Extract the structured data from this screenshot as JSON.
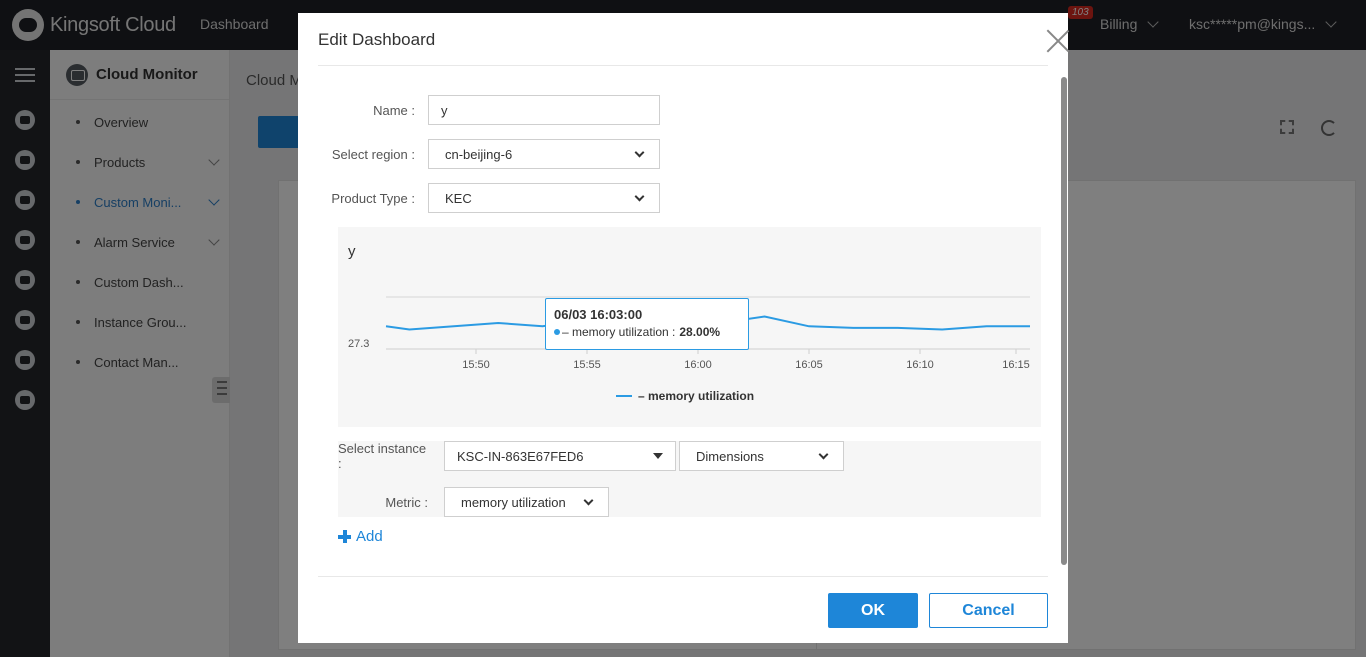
{
  "topbar": {
    "logo_text": "Kingsoft Cloud",
    "nav_dashboard": "Dashboard",
    "badge_count": "103",
    "billing_label": "Billing",
    "user_label": "ksc*****pm@kings..."
  },
  "sidebar": {
    "title": "Cloud Monitor",
    "items": [
      {
        "label": "Overview"
      },
      {
        "label": "Products"
      },
      {
        "label": "Custom Moni..."
      },
      {
        "label": "Alarm Service"
      },
      {
        "label": "Custom Dash..."
      },
      {
        "label": "Instance Grou..."
      },
      {
        "label": "Contact Man..."
      }
    ]
  },
  "content": {
    "breadcrumb": "Cloud M"
  },
  "modal": {
    "title": "Edit Dashboard",
    "name_label": "Name :",
    "name_value": "y",
    "region_label": "Select region :",
    "region_value": "cn-beijing-6",
    "product_label": "Product Type :",
    "product_value": "KEC",
    "instance_label": "Select instance :",
    "instance_value": "KSC-IN-863E67FED6",
    "dimensions_value": "Dimensions",
    "metric_label": "Metric :",
    "metric_value": "memory utilization",
    "add_label": "Add",
    "ok_label": "OK",
    "cancel_label": "Cancel"
  },
  "chart_data": {
    "type": "line",
    "title": "y",
    "x_ticks": [
      "15:50",
      "15:55",
      "16:00",
      "16:05",
      "16:10",
      "16:15"
    ],
    "y_ticks": [
      27.3
    ],
    "series": [
      {
        "name": "– memory utilization",
        "color": "#2b9be3",
        "x_minutes": [
          -15,
          -13,
          -11,
          -9,
          -7,
          -5,
          -3,
          -1,
          0,
          1,
          3,
          5,
          7,
          9,
          11,
          13,
          15,
          17,
          19
        ],
        "values": [
          28.0,
          27.9,
          28.0,
          28.1,
          28.0,
          28.2,
          28.1,
          28.4,
          28.6,
          28.1,
          28.3,
          28.0,
          27.95,
          27.95,
          27.9,
          28.0,
          28.0,
          28.0,
          28.0
        ]
      }
    ],
    "tooltip": {
      "time": "06/03 16:03:00",
      "series": "– memory utilization :",
      "value": "28.00%"
    },
    "legend_position": "bottom"
  }
}
